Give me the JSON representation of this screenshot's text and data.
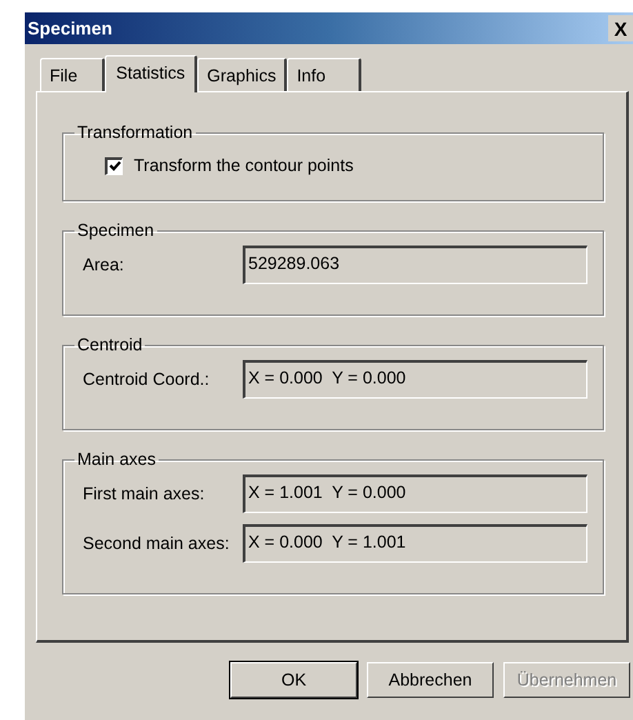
{
  "window": {
    "title": "Specimen",
    "close_glyph": "X"
  },
  "tabs": [
    {
      "label": "File",
      "selected": false
    },
    {
      "label": "Statistics",
      "selected": true
    },
    {
      "label": "Graphics",
      "selected": false
    },
    {
      "label": "Info",
      "selected": false
    }
  ],
  "groups": [
    {
      "title": "Transformation",
      "kind": "checkbox",
      "label": "Transform the contour points",
      "checked": true
    },
    {
      "title": "Specimen",
      "kind": "fields",
      "fields": [
        {
          "label": "Area:",
          "value": "529289.063"
        }
      ]
    },
    {
      "title": "Centroid",
      "kind": "fields",
      "fields": [
        {
          "label": "Centroid Coord.:",
          "value": "X = 0.000  Y = 0.000"
        }
      ]
    },
    {
      "title": "Main axes",
      "kind": "fields",
      "fields": [
        {
          "label": "First main axes:",
          "value": "X = 1.001  Y = 0.000"
        },
        {
          "label": "Second main axes:",
          "value": "X = 0.000  Y = 1.001"
        }
      ]
    }
  ],
  "buttons": [
    {
      "label": "OK",
      "default": true,
      "disabled": false
    },
    {
      "label": "Abbrechen",
      "default": false,
      "disabled": false
    },
    {
      "label": "Übernehmen",
      "default": false,
      "disabled": true
    }
  ]
}
